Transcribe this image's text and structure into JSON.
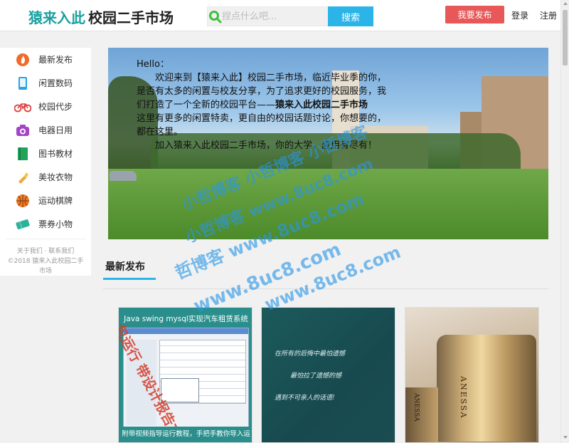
{
  "header": {
    "brand": "猿来入此",
    "title": "校园二手市场",
    "search_placeholder": "捏点什么吧...",
    "search_button": "搜索",
    "publish_button": "我要发布",
    "login": "登录",
    "register": "注册",
    "accent_color": "#2bb4e8",
    "publish_color": "#e85858"
  },
  "sidebar": {
    "items": [
      {
        "label": "最新发布",
        "icon": "fire-icon"
      },
      {
        "label": "闲置数码",
        "icon": "phone-icon"
      },
      {
        "label": "校园代步",
        "icon": "bicycle-icon"
      },
      {
        "label": "电器日用",
        "icon": "camera-icon"
      },
      {
        "label": "图书教材",
        "icon": "book-icon"
      },
      {
        "label": "美妆衣物",
        "icon": "lipstick-icon"
      },
      {
        "label": "运动棋牌",
        "icon": "basketball-icon"
      },
      {
        "label": "票券小物",
        "icon": "ticket-icon"
      }
    ],
    "footer_links": "关于我们 · 联系我们",
    "copyright": "©2018 猿来入此校园二手市场"
  },
  "banner": {
    "greeting": "Hello：",
    "para1_before": "欢迎来到【猿来入此】校园二手市场，临近毕业季的你，是否有太多的闲置与校友分享，为了追求更好的校园服务，我们打造了一个全新的校园平台——",
    "para1_bold": "猿来入此校园二手市场",
    "para2": "这里有更多的闲置特卖，更自由的校园话题讨论，你想要的，都在这里。",
    "para3": "加入猿来入此校园二手市场，你的大学，应用有尽有！"
  },
  "section": {
    "title": "最新发布"
  },
  "cards": [
    {
      "title": "Java swing mysql实现汽车租赁系统",
      "overlay": "包运行 带设计报告文档",
      "caption": "附带视频指导运行教程，手把手教你导入运行"
    },
    {
      "lines": [
        "在所有的后悔中最怕遗憾",
        "最怕拉了遗憾的憾",
        "遇到不可亲人的话语!"
      ]
    },
    {
      "brand_text": "ANESSA",
      "brand_text2": "ANESSA"
    }
  ],
  "watermark": {
    "line1": "小哲博客 小哲博客 小哲博客",
    "line2": "小哲博客 www.8uc8.com",
    "line3": "哲博客 www.8uc8.com",
    "line4": "www.8uc8.com",
    "line5": "www.8uc8.com"
  }
}
